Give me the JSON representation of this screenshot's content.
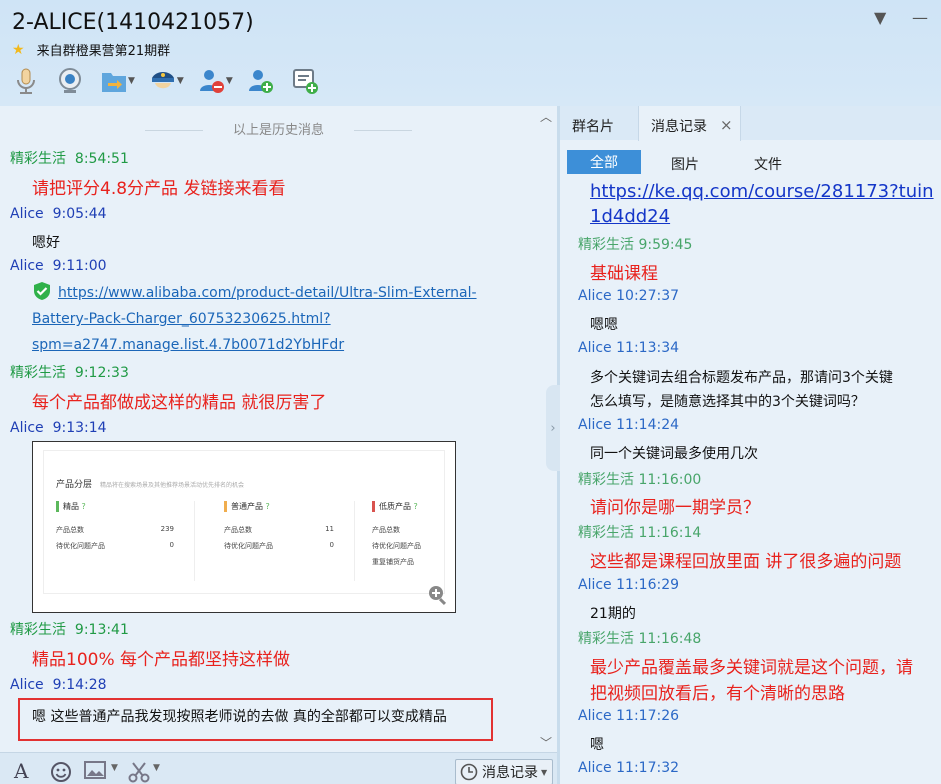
{
  "window": {
    "title": "2-ALICE(1410421057)",
    "subtitle": "来自群橙果营第21期群"
  },
  "chat": {
    "history_divider": "以上是历史消息",
    "messages": [
      {
        "sender": "精彩生活",
        "time": "8:54:51",
        "text": "请把评分4.8分产品 发链接来看看"
      },
      {
        "sender": "Alice",
        "time": "9:05:44",
        "text": "嗯好"
      },
      {
        "sender": "Alice",
        "time": "9:11:00",
        "link_lines": [
          "https://www.alibaba.com/product-detail/Ultra-Slim-External-",
          "Battery-Pack-Charger_60753230625.html?",
          "spm=a2747.manage.list.4.7b0071d2YbHFdr"
        ]
      },
      {
        "sender": "精彩生活",
        "time": "9:12:33",
        "text": "每个产品都做成这样的精品 就很厉害了"
      },
      {
        "sender": "Alice",
        "time": "9:13:14"
      },
      {
        "sender": "精彩生活",
        "time": "9:13:41",
        "text": "精品100% 每个产品都坚持这样做"
      },
      {
        "sender": "Alice",
        "time": "9:14:28"
      }
    ],
    "draft": "嗯 这些普通产品我发现按照老师说的去做 真的全部都可以变成精品"
  },
  "screenshot": {
    "title": "产品分层",
    "subtitle": "精品将在搜索场景及其他推荐场景活动优先排名的机会",
    "columns": [
      {
        "name": "精品",
        "color": "#5cb85c",
        "row1_label": "产品总数",
        "row1_value": "239",
        "row2_label": "待优化问题产品",
        "row2_value": "0"
      },
      {
        "name": "普通产品",
        "color": "#f0ad4e",
        "row1_label": "产品总数",
        "row1_value": "11",
        "row2_label": "待优化问题产品",
        "row2_value": "0"
      },
      {
        "name": "低质产品",
        "color": "#d9534f",
        "row1_label": "产品总数",
        "row2_label": "待优化问题产品",
        "row3_label": "重复铺货产品"
      }
    ]
  },
  "bottom": {
    "history_button": "消息记录"
  },
  "right": {
    "tabs": [
      "群名片",
      "消息记录"
    ],
    "filters": [
      "全部",
      "图片",
      "文件"
    ],
    "link_lines": [
      "https://ke.qq.com/course/281173?tuin",
      "1d4dd24"
    ],
    "messages": [
      {
        "sender": "精彩生活",
        "time": "9:59:45",
        "text": "基础课程"
      },
      {
        "sender": "Alice",
        "time": "10:27:37",
        "text": "嗯嗯"
      },
      {
        "sender": "Alice",
        "time": "11:13:34",
        "lines": [
          "多个关键词去组合标题发布产品，那请问3个关键",
          "怎么填写，是随意选择其中的3个关键词吗？"
        ]
      },
      {
        "sender": "Alice",
        "time": "11:14:24",
        "text": "同一个关键词最多使用几次"
      },
      {
        "sender": "精彩生活",
        "time": "11:16:00",
        "text": "请问你是哪一期学员？"
      },
      {
        "sender": "精彩生活",
        "time": "11:16:14",
        "text": "这些都是课程回放里面 讲了很多遍的问题"
      },
      {
        "sender": "Alice",
        "time": "11:16:29",
        "text": "21期的"
      },
      {
        "sender": "精彩生活",
        "time": "11:16:48",
        "lines": [
          "最少产品覆盖最多关键词就是这个问题，请",
          "把视频回放看后，有个清晰的思路"
        ]
      },
      {
        "sender": "Alice",
        "time": "11:17:26",
        "text": "嗯"
      },
      {
        "sender": "Alice",
        "time": "11:17:32"
      }
    ]
  }
}
